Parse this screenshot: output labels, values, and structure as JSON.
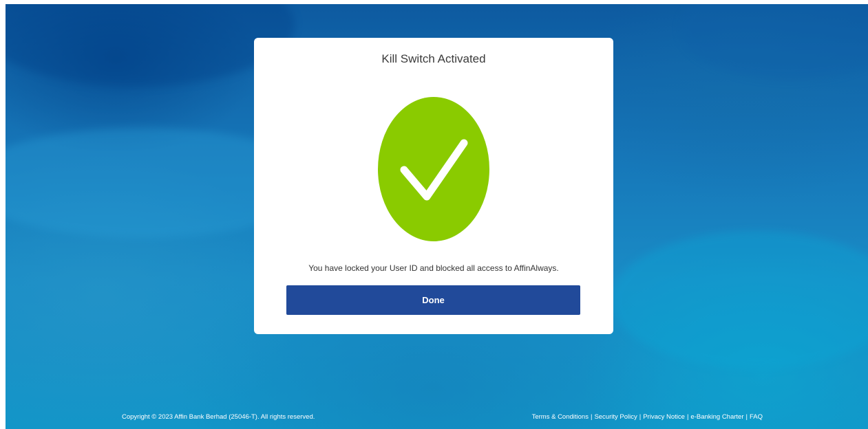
{
  "dialog": {
    "title": "Kill Switch Activated",
    "message": "You have locked your User ID and blocked all access to AffinAlways.",
    "done_label": "Done",
    "status_icon": "check-circle-icon"
  },
  "footer": {
    "copyright": "Copyright © 2023 Affin Bank Berhad (25046-T). All rights reserved.",
    "links": [
      {
        "label": "Terms & Conditions"
      },
      {
        "label": "Security Policy"
      },
      {
        "label": "Privacy Notice"
      },
      {
        "label": "e-Banking Charter"
      },
      {
        "label": "FAQ"
      }
    ],
    "separator": "|"
  },
  "colors": {
    "button": "#214a9a",
    "check": "#8acb00",
    "background": "#1676b8"
  }
}
